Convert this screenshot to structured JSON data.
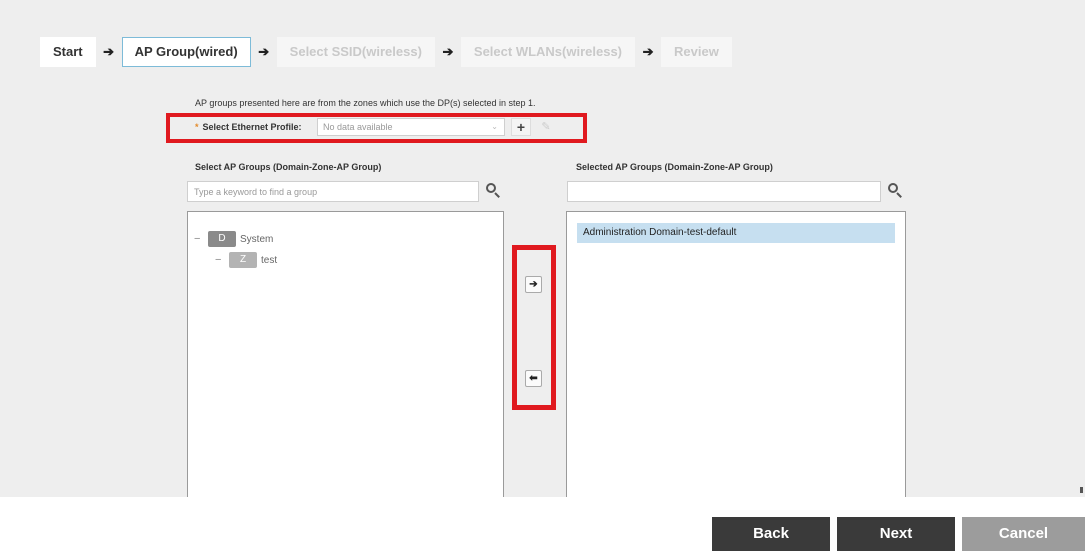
{
  "steps": [
    {
      "label": "Start",
      "state": "done"
    },
    {
      "label": "AP Group(wired)",
      "state": "active"
    },
    {
      "label": "Select SSID(wireless)",
      "state": "disabled"
    },
    {
      "label": "Select WLANs(wireless)",
      "state": "disabled"
    },
    {
      "label": "Review",
      "state": "disabled"
    }
  ],
  "step_arrow": "➔",
  "info_text": "AP groups presented here are from the zones which use the DP(s) selected in step 1.",
  "ethernet": {
    "required_mark": "*",
    "label": "Select Ethernet Profile:",
    "value": "No data available",
    "add_icon": "plus-icon",
    "edit_icon": "pencil-icon"
  },
  "left_panel": {
    "title": "Select AP Groups (Domain-Zone-AP Group)",
    "search_placeholder": "Type a keyword to find a group",
    "tree": [
      {
        "badge": "D",
        "label": "System",
        "level": 0
      },
      {
        "badge": "Z",
        "label": "test",
        "level": 1
      }
    ]
  },
  "right_panel": {
    "title": "Selected AP Groups (Domain-Zone-AP Group)",
    "search_placeholder": "",
    "items": [
      "Administration Domain-test-default"
    ]
  },
  "move": {
    "right": "➔",
    "left": "⬅"
  },
  "buttons": {
    "back": "Back",
    "next": "Next",
    "cancel": "Cancel"
  },
  "colors": {
    "highlight_border": "#e0191f",
    "active_step_border": "#7dbbd8",
    "selected_row": "#c6dff0",
    "primary_button": "#3a3a3a",
    "cancel_button": "#9c9c9c"
  }
}
